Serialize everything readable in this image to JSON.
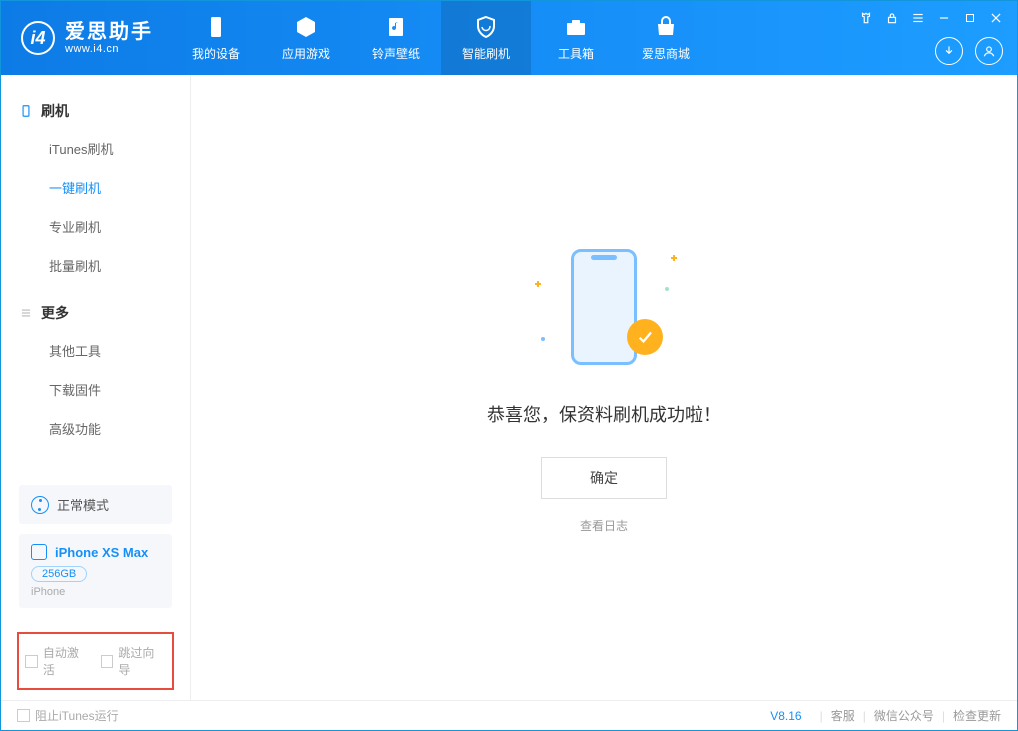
{
  "app": {
    "title": "爱思助手",
    "subtitle": "www.i4.cn"
  },
  "nav": {
    "device": "我的设备",
    "apps": "应用游戏",
    "ringtones": "铃声壁纸",
    "flash": "智能刷机",
    "toolbox": "工具箱",
    "store": "爱思商城"
  },
  "sidebar": {
    "flash_section": "刷机",
    "items_flash": {
      "itunes": "iTunes刷机",
      "oneclick": "一键刷机",
      "pro": "专业刷机",
      "batch": "批量刷机"
    },
    "more_section": "更多",
    "items_more": {
      "other_tools": "其他工具",
      "download_fw": "下载固件",
      "advanced": "高级功能"
    },
    "mode": "正常模式",
    "device_name": "iPhone XS Max",
    "device_storage": "256GB",
    "device_type": "iPhone",
    "auto_activate": "自动激活",
    "skip_guide": "跳过向导"
  },
  "main": {
    "success_msg": "恭喜您，保资料刷机成功啦！",
    "confirm": "确定",
    "view_log": "查看日志"
  },
  "footer": {
    "block_itunes": "阻止iTunes运行",
    "version": "V8.16",
    "support": "客服",
    "wechat": "微信公众号",
    "update": "检查更新"
  }
}
